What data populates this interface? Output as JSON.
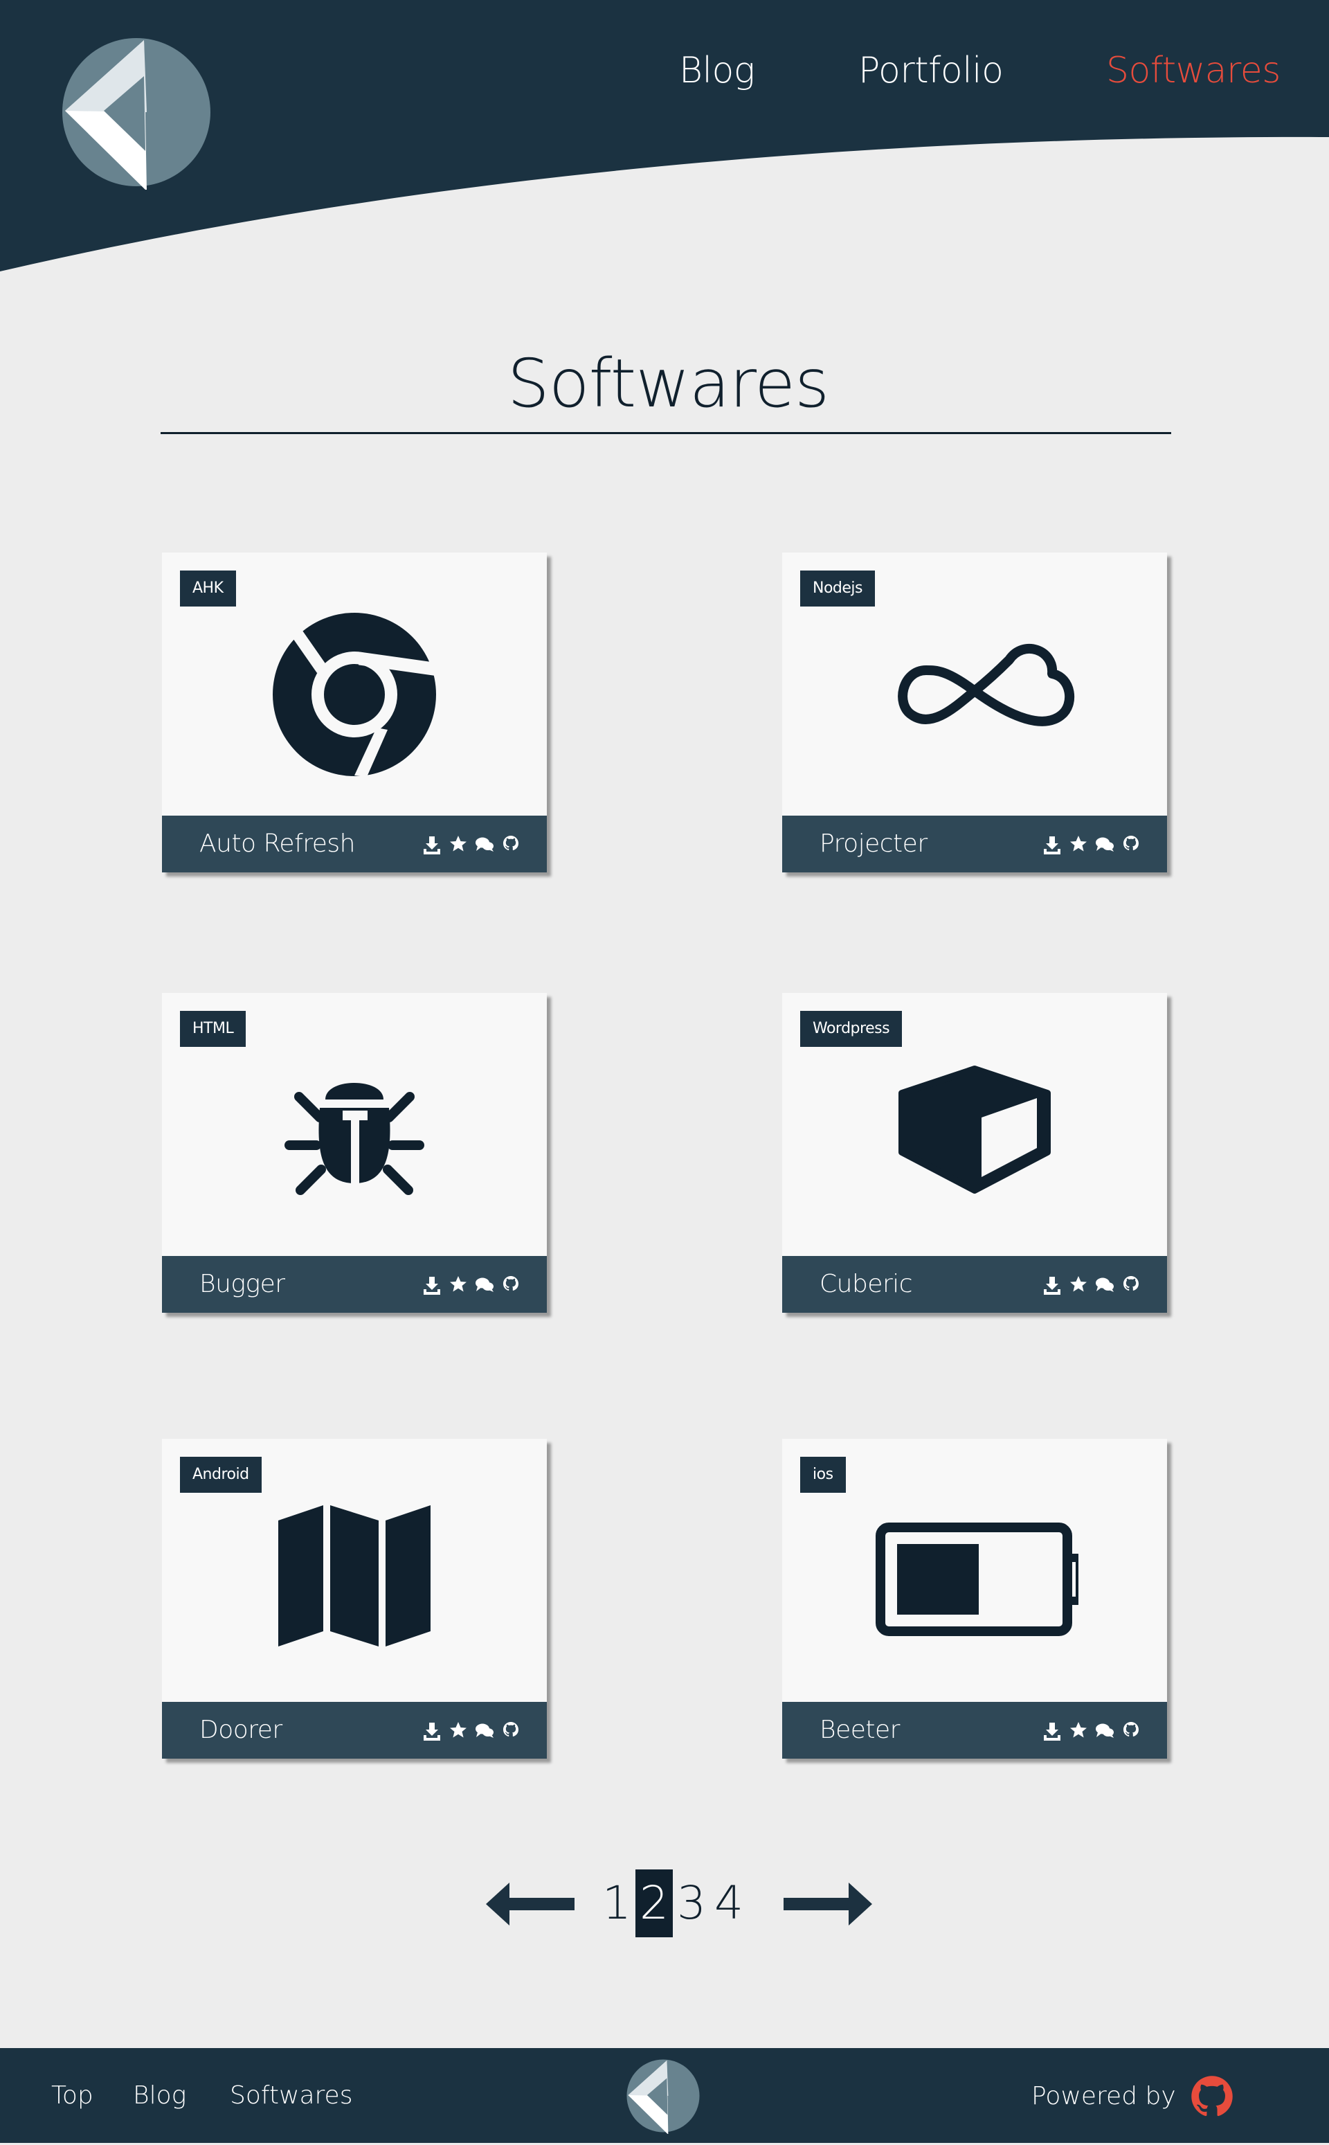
{
  "header": {
    "nav": [
      {
        "label": "Blog",
        "active": false
      },
      {
        "label": "Portfolio",
        "active": false
      },
      {
        "label": "Softwares",
        "active": true
      }
    ]
  },
  "main": {
    "title": "Softwares",
    "cards": [
      {
        "tag": "AHK",
        "name": "Auto Refresh",
        "icon": "chrome-icon"
      },
      {
        "tag": "Nodejs",
        "name": "Projecter",
        "icon": "cloud-infinity-icon"
      },
      {
        "tag": "HTML",
        "name": "Bugger",
        "icon": "bug-icon"
      },
      {
        "tag": "Wordpress",
        "name": "Cuberic",
        "icon": "cube-icon"
      },
      {
        "tag": "Android",
        "name": "Doorer",
        "icon": "map-icon"
      },
      {
        "tag": "ios",
        "name": "Beeter",
        "icon": "battery-icon"
      }
    ],
    "card_actions": [
      "download-icon",
      "star-icon",
      "comments-icon",
      "github-icon"
    ],
    "pagination": {
      "pages": [
        "1",
        "2",
        "3",
        "4"
      ],
      "current": "2"
    }
  },
  "footer": {
    "links": [
      "Top",
      "Blog",
      "Softwares"
    ],
    "powered_by": "Powered by"
  },
  "colors": {
    "header_bg": "#1b3241",
    "accent": "#e74c3c",
    "card_footer": "#2f4857",
    "icon": "#10202d",
    "page_bg": "#ededed"
  }
}
